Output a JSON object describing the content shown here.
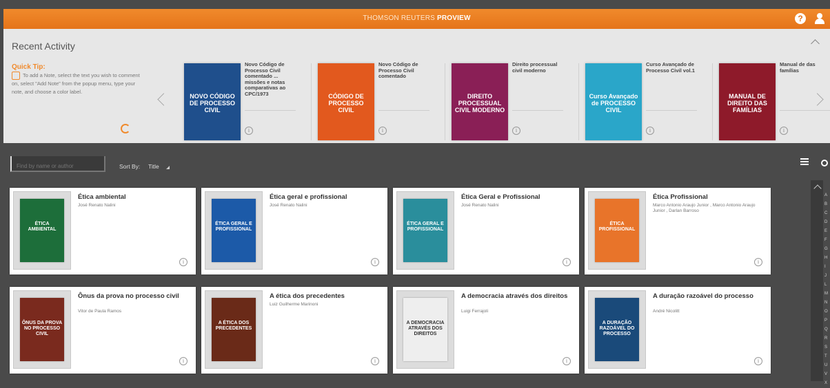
{
  "topbar": {
    "brand_prefix": "THOMSON REUTERS",
    "brand_name": "PROVIEW",
    "help_label": "?"
  },
  "recent": {
    "title": "Recent Activity",
    "quick_tip_title": "Quick Tip:",
    "quick_tip_text": "To add a Note, select the text you wish to comment on, select \"Add Note\" from the popup menu, type your note, and choose a color label.",
    "books": [
      {
        "title": "Novo Código de Processo Civil comentado ... missões e notas comparativas ao CPC/1973",
        "cover_text": "NOVO CÓDIGO DE PROCESSO CIVIL",
        "cover_color": "#1f4f8c"
      },
      {
        "title": "Novo Código de Processo Civil comentado",
        "cover_text": "CÓDIGO DE PROCESSO CIVIL",
        "cover_color": "#e2591e"
      },
      {
        "title": "Direito processual civil moderno",
        "cover_text": "DIREITO PROCESSUAL CIVIL MODERNO",
        "cover_color": "#8a1f56"
      },
      {
        "title": "Curso Avançado de Processo Civil vol.1",
        "cover_text": "Curso Avançado de PROCESSO CIVIL",
        "cover_color": "#2aa6c9"
      },
      {
        "title": "Manual de das famílias",
        "cover_text": "MANUAL DE DIREITO DAS FAMÍLIAS",
        "cover_color": "#8e1a2a"
      }
    ]
  },
  "toolbar": {
    "search_placeholder": "Find by name or author",
    "sort_label": "Sort By:",
    "sort_value": "Title"
  },
  "library": [
    {
      "title": "Ética ambiental",
      "author": "José Renato Nalini",
      "cover_text": "ÉTICA AMBIENTAL",
      "cover_color": "#1d6e3a"
    },
    {
      "title": "Ética geral e profissional",
      "author": "José Renato Nalini",
      "cover_text": "ÉTICA GERAL E PROFISSIONAL",
      "cover_color": "#1c5aa8"
    },
    {
      "title": "Ética Geral e Profissional",
      "author": "José Renato Nalini",
      "cover_text": "ÉTICA GERAL E PROFISSIONAL",
      "cover_color": "#2a8e9c"
    },
    {
      "title": "Ética Profissional",
      "author": "Marco Antonio Araujo Junior , Marco Antonio Araujo Junior , Darlan Barroso",
      "cover_text": "ÉTICA PROFISSIONAL",
      "cover_color": "#e8742a"
    },
    {
      "title": "Ônus da prova no processo civil",
      "author": "Vitor de Paula Ramos",
      "cover_text": "ÔNUS DA PROVA NO PROCESSO CIVIL",
      "cover_color": "#7a2a1e"
    },
    {
      "title": "A ética dos precedentes",
      "author": "Luiz Guilherme Marinoni",
      "cover_text": "A ÉTICA DOS PRECEDENTES",
      "cover_color": "#6a2a18"
    },
    {
      "title": "A democracia através dos direitos",
      "author": "Luigi Ferrajoli",
      "cover_text": "A DEMOCRACIA ATRAVÉS DOS DIREITOS",
      "cover_color": "#eeeeee"
    },
    {
      "title": "A duração razoável do processo",
      "author": "André Nicolitt",
      "cover_text": "A DURAÇÃO RAZOÁVEL DO PROCESSO",
      "cover_color": "#1a4a7a"
    }
  ],
  "alphabet": [
    "A",
    "B",
    "C",
    "D",
    "E",
    "F",
    "G",
    "H",
    "I",
    "J",
    "L",
    "M",
    "N",
    "O",
    "P",
    "Q",
    "R",
    "S",
    "T",
    "U",
    "V",
    "X"
  ]
}
